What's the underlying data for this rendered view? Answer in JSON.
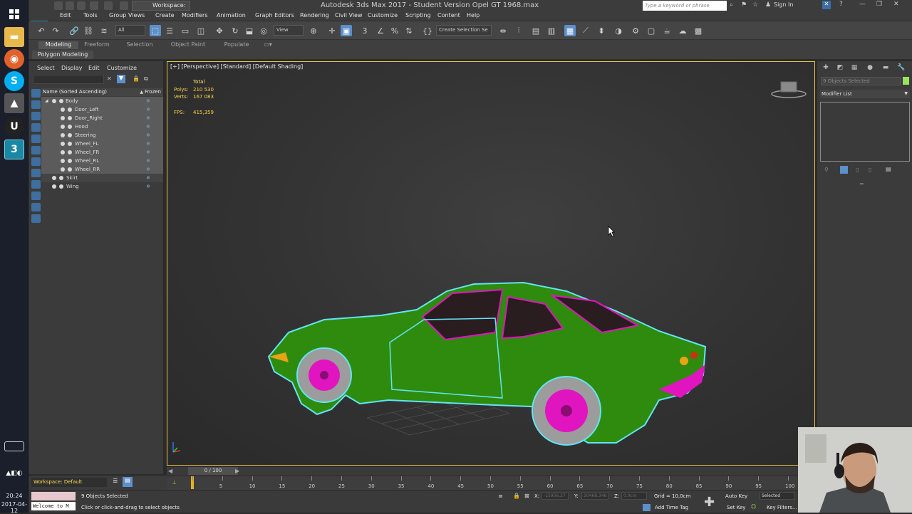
{
  "taskbar": {
    "time": "20:24",
    "date": "2017-04-12",
    "apps": [
      "windows-logo-icon",
      "file-explorer-icon",
      "firefox-icon",
      "skype-icon",
      "gimp-icon",
      "unreal-engine-icon",
      "3ds-max-icon"
    ]
  },
  "title": {
    "app_title": "Autodesk 3ds Max 2017 - Student Version    Opel GT 1968.max",
    "workspace": "Workspace: Default",
    "search_placeholder": "Type a keyword or phrase",
    "signin": "Sign In"
  },
  "menu": [
    "Edit",
    "Tools",
    "Group",
    "Views",
    "Create",
    "Modifiers",
    "Animation",
    "Graph Editors",
    "Rendering",
    "Civil View",
    "Customize",
    "Scripting",
    "Content",
    "Help"
  ],
  "toolbar": {
    "filter": "All",
    "view": "View",
    "selection_set": "Create Selection Se"
  },
  "ribbon": {
    "tabs": [
      "Modeling",
      "Freeform",
      "Selection",
      "Object Paint",
      "Populate"
    ],
    "sub_label": "Polygon Modeling"
  },
  "explorer": {
    "menu": [
      "Select",
      "Display",
      "Edit",
      "Customize"
    ],
    "col_name": "Name (Sorted Ascending)",
    "col_frozen": "Frozen",
    "items": [
      {
        "label": "Body",
        "level": 0
      },
      {
        "label": "Door_Left",
        "level": 1
      },
      {
        "label": "Door_Right",
        "level": 1
      },
      {
        "label": "Hood",
        "level": 1
      },
      {
        "label": "Steering",
        "level": 1
      },
      {
        "label": "Wheel_FL",
        "level": 1
      },
      {
        "label": "Wheel_FR",
        "level": 1
      },
      {
        "label": "Wheel_RL",
        "level": 1
      },
      {
        "label": "Wheel_RR",
        "level": 1
      },
      {
        "label": "Skirt",
        "level": 0
      },
      {
        "label": "Wing",
        "level": 0
      }
    ]
  },
  "viewport": {
    "label": "[+] [Perspective] [Standard] [Default Shading]",
    "stats": {
      "total_label": "Total",
      "polys_label": "Polys:",
      "polys_value": "210 530",
      "verts_label": "Verts:",
      "verts_value": "167 083",
      "fps_label": "FPS:",
      "fps_value": "415,359"
    },
    "colors": {
      "body": "#2e8b0e",
      "rims": "#e015c0",
      "outline": "#62e4f5",
      "tires": "#9c9c9c"
    }
  },
  "command_panel": {
    "selected_field": "9 Objects Selected",
    "modifier_list": "Modifier List"
  },
  "timeline": {
    "frame": "0 / 100",
    "ticks": [
      "5",
      "10",
      "15",
      "20",
      "25",
      "30",
      "35",
      "40",
      "45",
      "50",
      "55",
      "60",
      "65",
      "70",
      "75",
      "80",
      "85",
      "90",
      "95",
      "100"
    ]
  },
  "status": {
    "workspace": "Workspace: Default",
    "maxscript": "Welcome to M",
    "objects_selected": "9 Objects Selected",
    "prompt": "Click or click-and-drag to select objects",
    "x_label": "X:",
    "x_value": "-15956,27",
    "y_label": "Y:",
    "y_value": "20468,346",
    "z_label": "Z:",
    "z_value": "0,0cm",
    "grid": "Grid = 10,0cm",
    "add_time_tag": "Add Time Tag",
    "auto_key": "Auto Key",
    "set_key": "Set Key",
    "key_mode": "Selected",
    "key_filters": "Key Filters..."
  }
}
